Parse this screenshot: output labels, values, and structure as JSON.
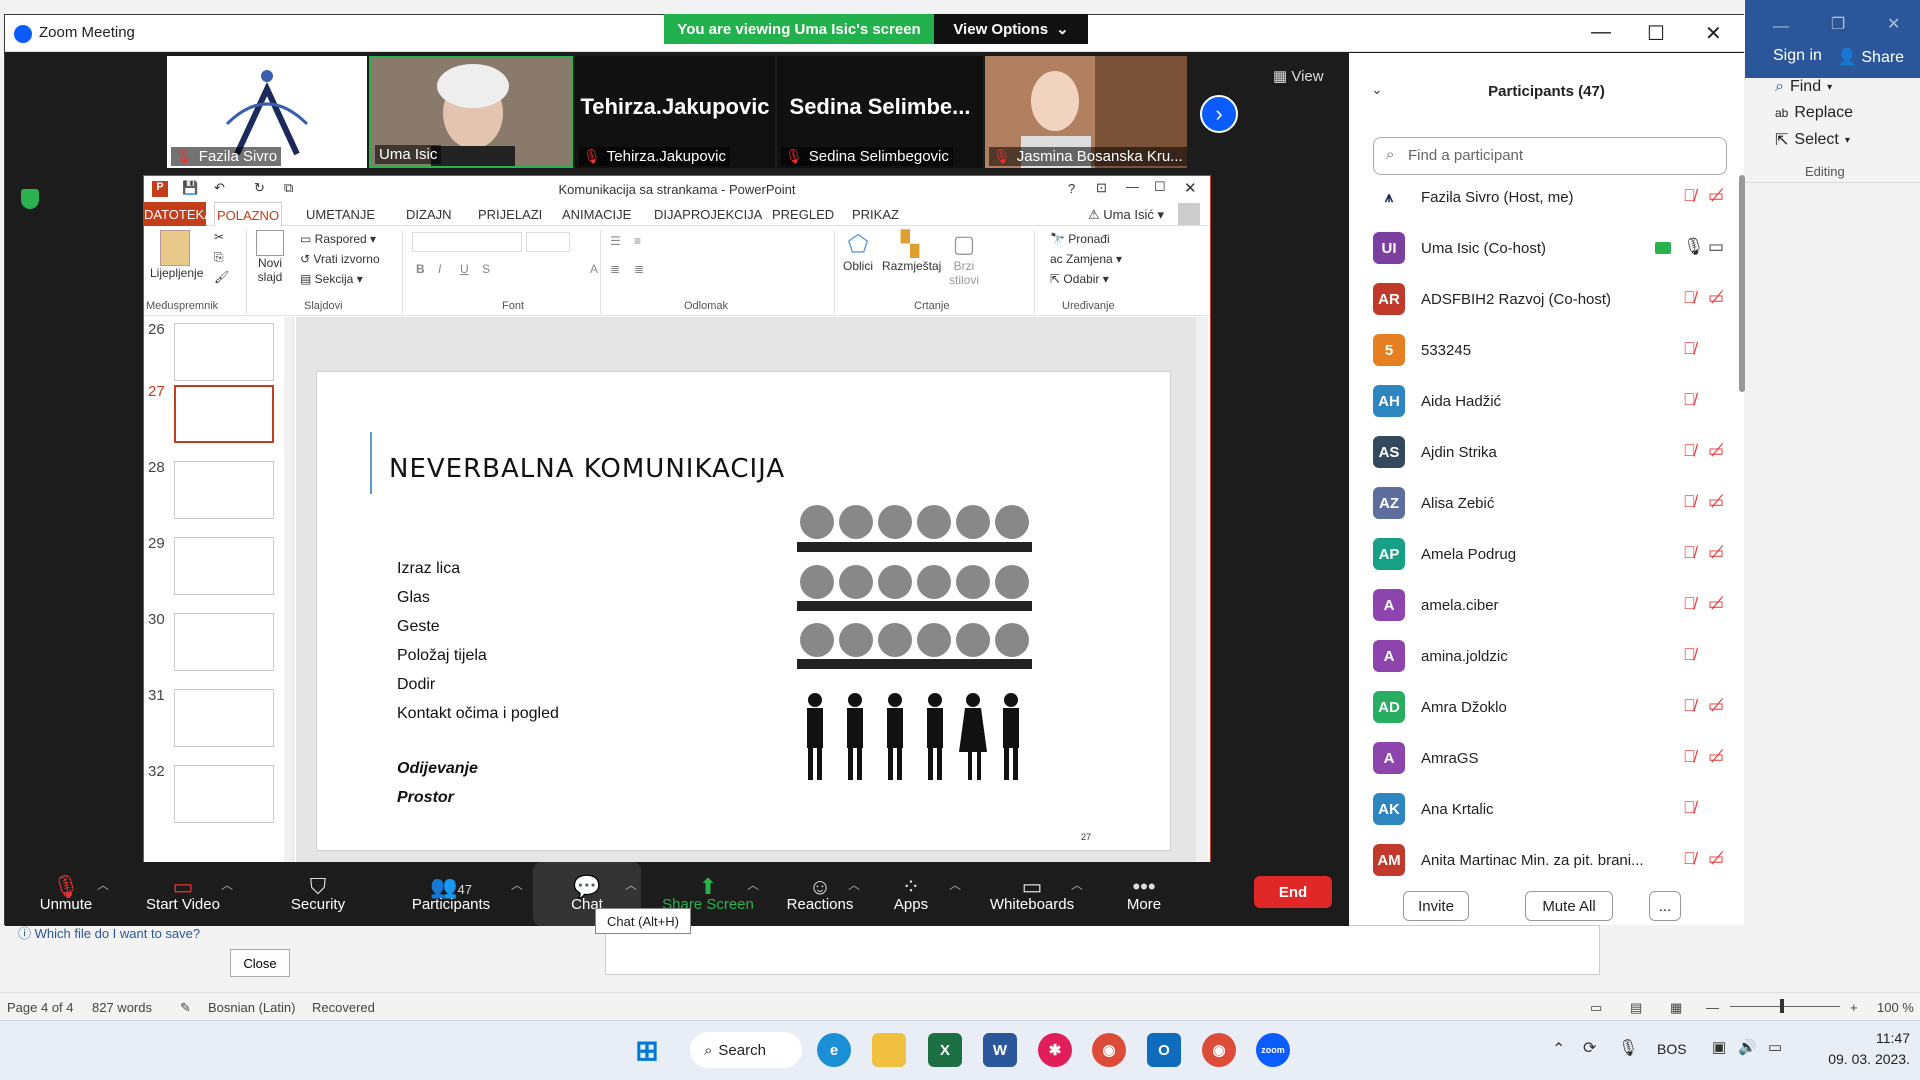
{
  "word": {
    "sign_in": "Sign in",
    "share": "Share",
    "find": "Find",
    "replace": "Replace",
    "select": "Select",
    "editing": "Editing",
    "help_link": "Which file do I want to save?",
    "close": "Close",
    "status": {
      "page": "Page 4 of 4",
      "words": "827 words",
      "language": "Bosnian (Latin)",
      "recovered": "Recovered",
      "zoom": "100 %"
    }
  },
  "zoom_window": {
    "title": "Zoom Meeting",
    "banner": "You are viewing Uma Isic's screen",
    "view_options": "View Options",
    "view": "View",
    "tiles": [
      {
        "name": "Fazila Sivro"
      },
      {
        "name": "Uma Isic"
      },
      {
        "name": "Tehirza.Jakupovic",
        "big": "Tehirza.Jakupovic"
      },
      {
        "name": "Sedina Selimbegovic",
        "big": "Sedina  Selimbe..."
      },
      {
        "name": "Jasmina Bosanska Kru..."
      }
    ],
    "toolbar": {
      "unmute": "Unmute",
      "start_video": "Start Video",
      "security": "Security",
      "participants": "Participants",
      "participants_count": "47",
      "chat": "Chat",
      "share_screen": "Share Screen",
      "reactions": "Reactions",
      "apps": "Apps",
      "whiteboards": "Whiteboards",
      "more": "More",
      "end": "End"
    },
    "tooltip": "Chat (Alt+H)"
  },
  "powerpoint": {
    "title": "Komunikacija sa strankama - PowerPoint",
    "user": "Uma Isić",
    "tabs": [
      "DATOTEKA",
      "POLAZNO",
      "UMETANJE",
      "DIZAJN",
      "PRIJELAZI",
      "ANIMACIJE",
      "DIJAPROJEKCIJA",
      "PREGLED",
      "PRIKAZ"
    ],
    "ribbon": {
      "paste": "Lijepljenje",
      "new_slide": "Novi slajd",
      "layout": "Raspored",
      "reset": "Vrati izvorno",
      "section": "Sekcija",
      "shapes": "Oblici",
      "arrange": "Razmještaj",
      "quick_styles": "Brzi stilovi",
      "find": "Pronađi",
      "replace": "Zamjena",
      "select": "Odabir",
      "groups": {
        "clipboard": "Međuspremnik",
        "slides": "Slajdovi",
        "font": "Font",
        "paragraph": "Odlomak",
        "drawing": "Crtanje",
        "editing": "Uređivanje"
      }
    },
    "slide_numbers": [
      "26",
      "27",
      "28",
      "29",
      "30",
      "31",
      "32"
    ],
    "slide": {
      "title": "NEVERBALNA KOMUNIKACIJA",
      "bullets": [
        "Izraz lica",
        "Glas",
        "Geste",
        "Položaj tijela",
        "Dodir",
        "Kontakt očima i pogled"
      ],
      "bullets2": [
        "Odijevanje",
        "Prostor"
      ],
      "number": "27"
    }
  },
  "participants_panel": {
    "title": "Participants (47)",
    "search_placeholder": "Find a participant",
    "list": [
      {
        "initials": "",
        "name": "Fazila Sivro (Host, me)",
        "color": "#ffffff",
        "mic": "off",
        "cam": "off"
      },
      {
        "initials": "UI",
        "name": "Uma Isic (Co-host)",
        "color": "#7b3fa0",
        "mic": "on",
        "cam": "on"
      },
      {
        "initials": "AR",
        "name": "ADSFBIH2 Razvoj (Co-host)",
        "color": "#c0392b",
        "mic": "off",
        "cam": "off"
      },
      {
        "initials": "5",
        "name": "533245",
        "color": "#e67e22",
        "mic": "off",
        "cam": ""
      },
      {
        "initials": "AH",
        "name": "Aida Hadžić",
        "color": "#2e86c1",
        "mic": "off",
        "cam": ""
      },
      {
        "initials": "AS",
        "name": "Ajdin Strika",
        "color": "#34495e",
        "mic": "off",
        "cam": "off"
      },
      {
        "initials": "AZ",
        "name": "Alisa Zebić",
        "color": "#5d6d9e",
        "mic": "off",
        "cam": "off"
      },
      {
        "initials": "AP",
        "name": "Amela Podrug",
        "color": "#16a085",
        "mic": "off",
        "cam": "off"
      },
      {
        "initials": "A",
        "name": "amela.ciber",
        "color": "#8e44ad",
        "mic": "off",
        "cam": "off"
      },
      {
        "initials": "A",
        "name": "amina.joldzic",
        "color": "#8e44ad",
        "mic": "off",
        "cam": ""
      },
      {
        "initials": "AD",
        "name": "Amra Džoklo",
        "color": "#27ae60",
        "mic": "off",
        "cam": "off"
      },
      {
        "initials": "A",
        "name": "AmraGS",
        "color": "#8e44ad",
        "mic": "off",
        "cam": "off"
      },
      {
        "initials": "AK",
        "name": "Ana Krtalic",
        "color": "#2e86c1",
        "mic": "off",
        "cam": ""
      },
      {
        "initials": "AM",
        "name": "Anita Martinac Min. za pit. brani...",
        "color": "#c0392b",
        "mic": "off",
        "cam": "off"
      }
    ],
    "invite": "Invite",
    "mute_all": "Mute All",
    "more": "..."
  },
  "taskbar": {
    "search": "Search",
    "lang": "BOS",
    "time": "11:47",
    "date": "09. 03. 2023."
  }
}
